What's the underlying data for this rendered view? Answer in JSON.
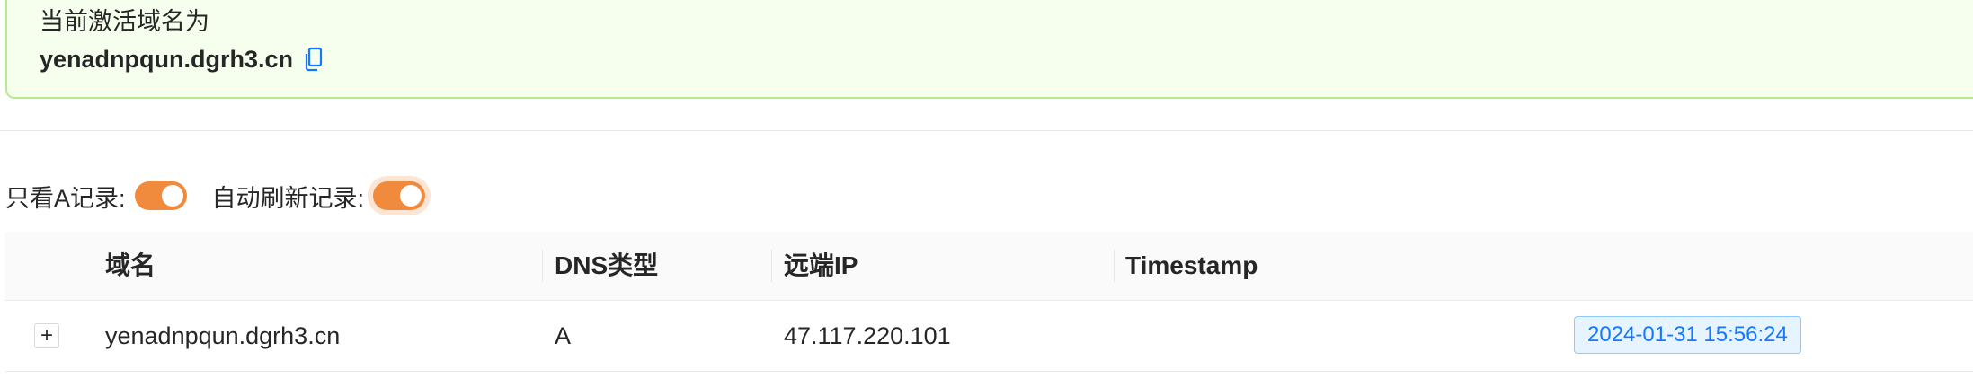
{
  "alert": {
    "title": "当前激活域名为",
    "domain": "yenadnpqun.dgrh3.cn",
    "copy_icon": "copy-icon"
  },
  "filters": {
    "only_a_label": "只看A记录:",
    "only_a_on": true,
    "auto_refresh_label": "自动刷新记录:",
    "auto_refresh_on": true
  },
  "table": {
    "columns": [
      "域名",
      "DNS类型",
      "远端IP",
      "Timestamp"
    ],
    "rows": [
      {
        "expand": "+",
        "domain": "yenadnpqun.dgrh3.cn",
        "dns_type": "A",
        "remote_ip": "47.117.220.101",
        "timestamp": "2024-01-31 15:56:24"
      }
    ]
  },
  "colors": {
    "success_bg": "#f6ffed",
    "success_border": "#b7eb8f",
    "switch_on": "#f08a3c",
    "tag_blue": "#1677ff"
  }
}
